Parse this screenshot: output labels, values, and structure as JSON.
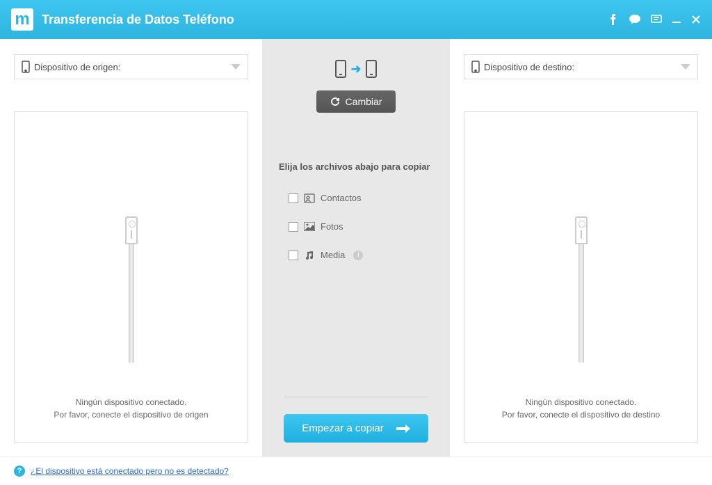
{
  "header": {
    "title": "Transferencia de Datos Teléfono"
  },
  "source": {
    "label": "Dispositivo de origen:",
    "no_device_line1": "Ningún dispositivo conectado.",
    "no_device_line2": "Por favor, conecte el dispositivo de origen"
  },
  "destination": {
    "label": "Dispositivo de destino:",
    "no_device_line1": "Ningún dispositivo conectado.",
    "no_device_line2": "Por favor, conecte el dispositivo de destino"
  },
  "center": {
    "swap_label": "Cambiar",
    "choose_title": "Elija los archivos abajo para copiar",
    "items": [
      {
        "label": "Contactos"
      },
      {
        "label": "Fotos"
      },
      {
        "label": "Media"
      }
    ],
    "start_label": "Empezar a copiar"
  },
  "footer": {
    "help_link": "¿El dispositivo está conectado pero no es detectado?"
  }
}
